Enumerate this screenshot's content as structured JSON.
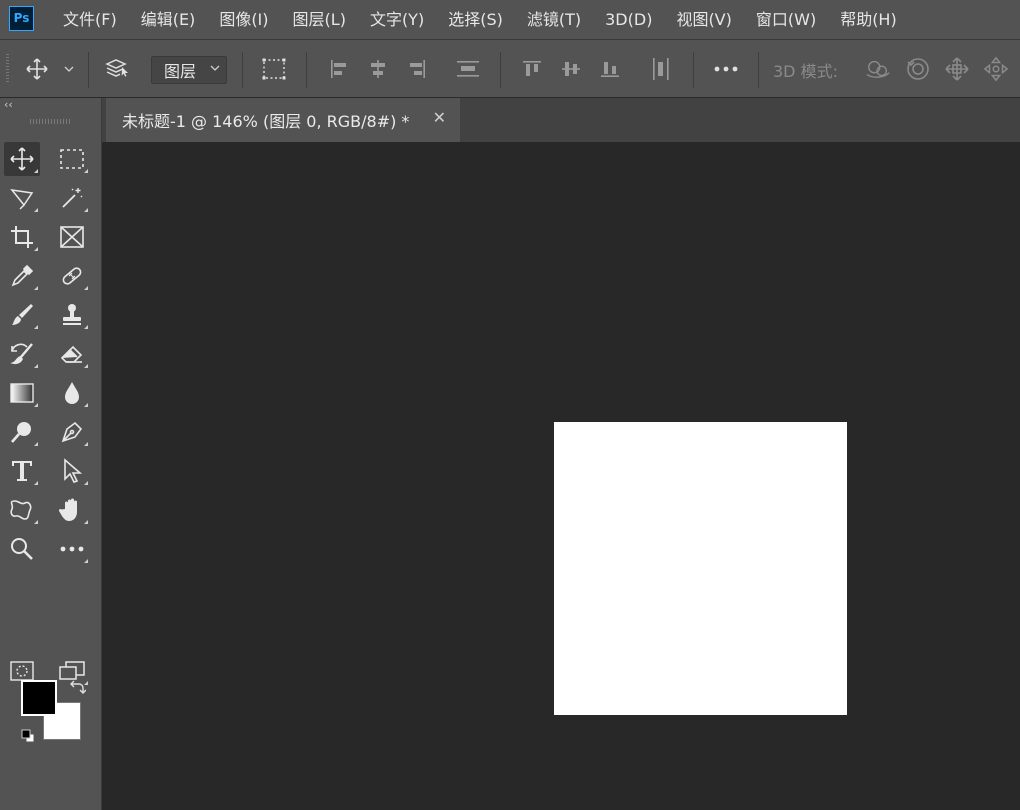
{
  "app": {
    "logo_text": "Ps"
  },
  "menu": [
    "文件(F)",
    "编辑(E)",
    "图像(I)",
    "图层(L)",
    "文字(Y)",
    "选择(S)",
    "滤镜(T)",
    "3D(D)",
    "视图(V)",
    "窗口(W)",
    "帮助(H)"
  ],
  "options": {
    "auto_select_target": "图层",
    "mode_3d_label": "3D 模式:"
  },
  "panel": {
    "collapse_label": "‹‹"
  },
  "document": {
    "tab_title": "未标题-1 @ 146% (图层 0, RGB/8#) *",
    "close_label": "✕"
  },
  "colors": {
    "foreground": "#000000",
    "background": "#ffffff",
    "ui_panel": "#535353",
    "workspace": "#282828"
  },
  "tools": [
    "move-tool",
    "rectangular-marquee-tool",
    "polygonal-lasso-tool",
    "magic-wand-tool",
    "crop-tool",
    "frame-tool",
    "eyedropper-tool",
    "spot-healing-brush-tool",
    "brush-tool",
    "clone-stamp-tool",
    "history-brush-tool",
    "eraser-tool",
    "gradient-tool",
    "blur-tool",
    "dodge-tool",
    "pen-tool",
    "type-tool",
    "path-selection-tool",
    "custom-shape-tool",
    "hand-tool",
    "zoom-tool",
    "edit-toolbar"
  ]
}
